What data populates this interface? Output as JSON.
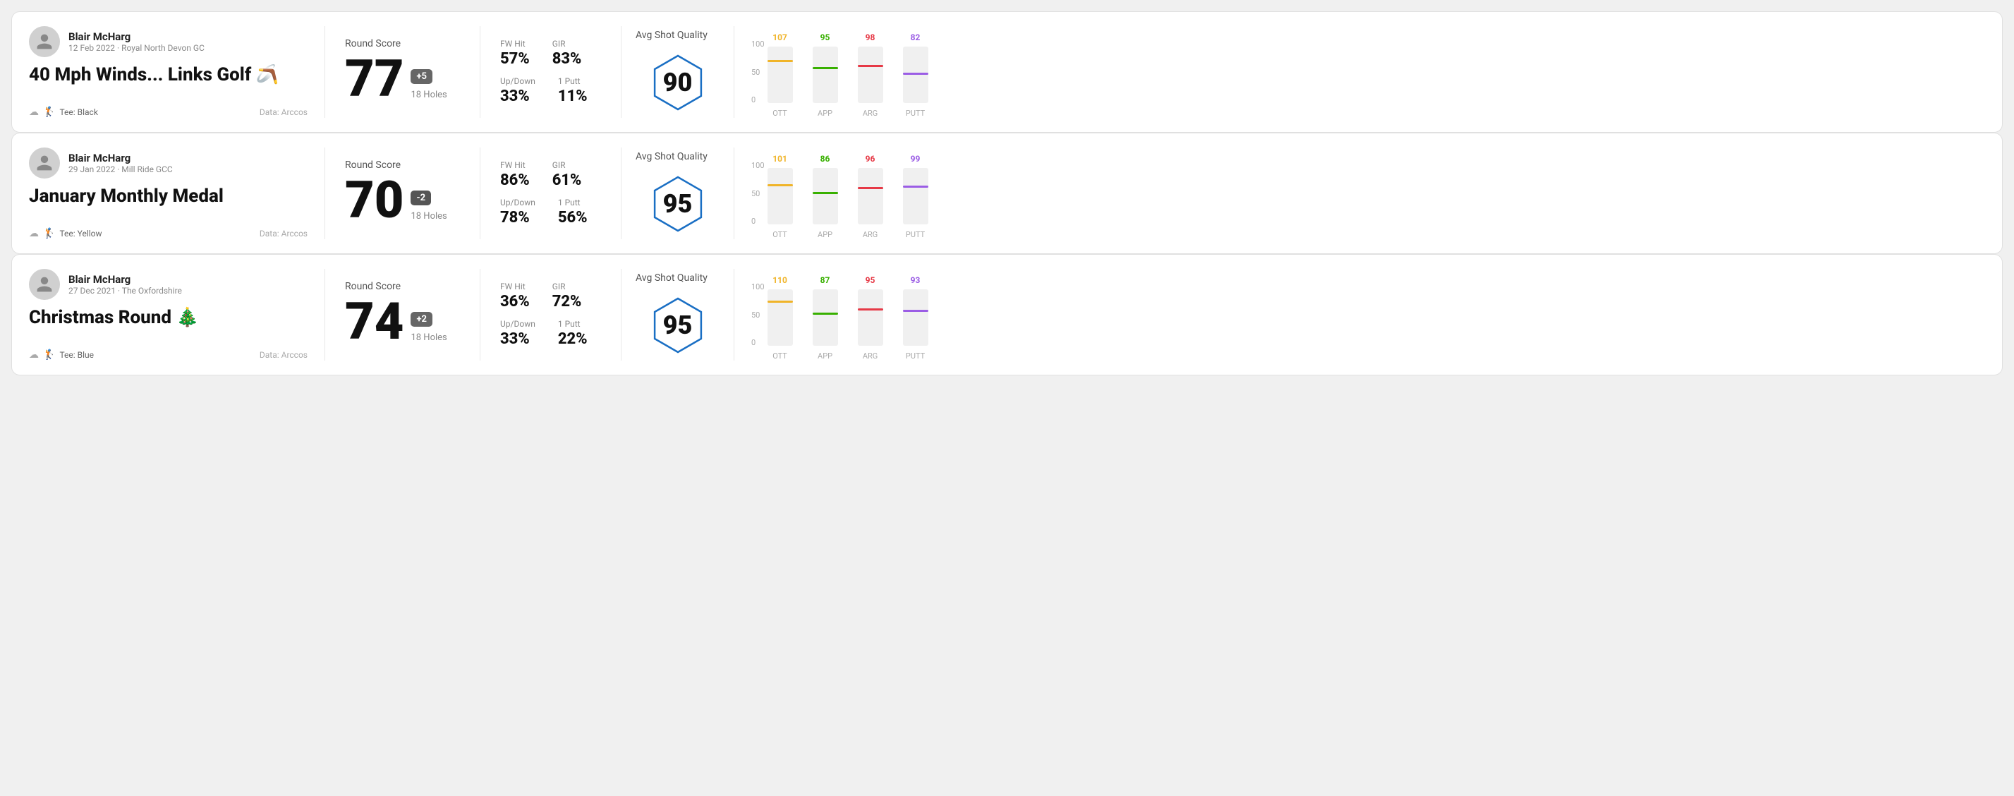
{
  "rounds": [
    {
      "id": "round1",
      "user": {
        "name": "Blair McHarg",
        "meta": "12 Feb 2022 · Royal North Devon GC"
      },
      "title": "40 Mph Winds... Links Golf 🪃",
      "tee": "Black",
      "data_source": "Data: Arccos",
      "score": {
        "label": "Round Score",
        "number": "77",
        "badge": "+5",
        "badge_type": "positive",
        "holes": "18 Holes"
      },
      "stats": {
        "fw_hit_label": "FW Hit",
        "fw_hit_value": "57%",
        "gir_label": "GIR",
        "gir_value": "83%",
        "updown_label": "Up/Down",
        "updown_value": "33%",
        "oneputt_label": "1 Putt",
        "oneputt_value": "11%"
      },
      "quality": {
        "label": "Avg Shot Quality",
        "score": "90"
      },
      "chart": {
        "columns": [
          {
            "label": "OTT",
            "value": 107,
            "color": "#f0b429",
            "bar_pct": 72
          },
          {
            "label": "APP",
            "value": 95,
            "color": "#38b000",
            "bar_pct": 60
          },
          {
            "label": "ARG",
            "value": 98,
            "color": "#e63946",
            "bar_pct": 64
          },
          {
            "label": "PUTT",
            "value": 82,
            "color": "#9b5de5",
            "bar_pct": 50
          }
        ],
        "y_labels": [
          "100",
          "50",
          "0"
        ]
      }
    },
    {
      "id": "round2",
      "user": {
        "name": "Blair McHarg",
        "meta": "29 Jan 2022 · Mill Ride GCC"
      },
      "title": "January Monthly Medal",
      "tee": "Yellow",
      "data_source": "Data: Arccos",
      "score": {
        "label": "Round Score",
        "number": "70",
        "badge": "-2",
        "badge_type": "negative",
        "holes": "18 Holes"
      },
      "stats": {
        "fw_hit_label": "FW Hit",
        "fw_hit_value": "86%",
        "gir_label": "GIR",
        "gir_value": "61%",
        "updown_label": "Up/Down",
        "updown_value": "78%",
        "oneputt_label": "1 Putt",
        "oneputt_value": "56%"
      },
      "quality": {
        "label": "Avg Shot Quality",
        "score": "95"
      },
      "chart": {
        "columns": [
          {
            "label": "OTT",
            "value": 101,
            "color": "#f0b429",
            "bar_pct": 68
          },
          {
            "label": "APP",
            "value": 86,
            "color": "#38b000",
            "bar_pct": 54
          },
          {
            "label": "ARG",
            "value": 96,
            "color": "#e63946",
            "bar_pct": 63
          },
          {
            "label": "PUTT",
            "value": 99,
            "color": "#9b5de5",
            "bar_pct": 65
          }
        ],
        "y_labels": [
          "100",
          "50",
          "0"
        ]
      }
    },
    {
      "id": "round3",
      "user": {
        "name": "Blair McHarg",
        "meta": "27 Dec 2021 · The Oxfordshire"
      },
      "title": "Christmas Round 🎄",
      "tee": "Blue",
      "data_source": "Data: Arccos",
      "score": {
        "label": "Round Score",
        "number": "74",
        "badge": "+2",
        "badge_type": "positive",
        "holes": "18 Holes"
      },
      "stats": {
        "fw_hit_label": "FW Hit",
        "fw_hit_value": "36%",
        "gir_label": "GIR",
        "gir_value": "72%",
        "updown_label": "Up/Down",
        "updown_value": "33%",
        "oneputt_label": "1 Putt",
        "oneputt_value": "22%"
      },
      "quality": {
        "label": "Avg Shot Quality",
        "score": "95"
      },
      "chart": {
        "columns": [
          {
            "label": "OTT",
            "value": 110,
            "color": "#f0b429",
            "bar_pct": 76
          },
          {
            "label": "APP",
            "value": 87,
            "color": "#38b000",
            "bar_pct": 55
          },
          {
            "label": "ARG",
            "value": 95,
            "color": "#e63946",
            "bar_pct": 62
          },
          {
            "label": "PUTT",
            "value": 93,
            "color": "#9b5de5",
            "bar_pct": 60
          }
        ],
        "y_labels": [
          "100",
          "50",
          "0"
        ]
      }
    }
  ]
}
